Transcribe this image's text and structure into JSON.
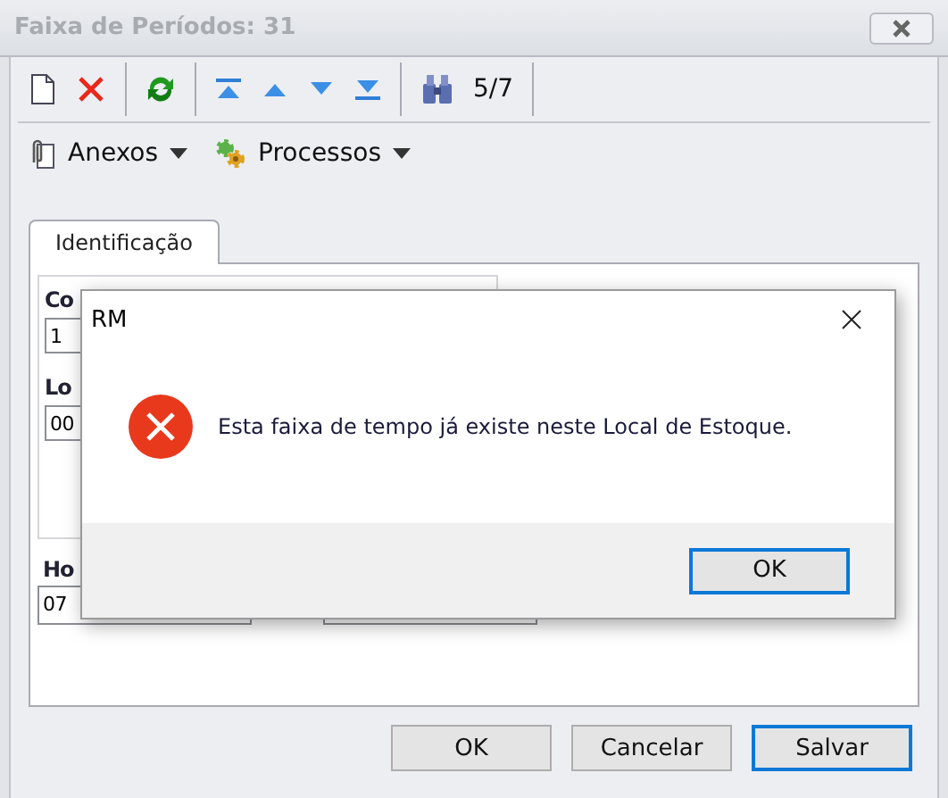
{
  "window": {
    "title": "Faixa de Períodos: 31"
  },
  "toolbar": {
    "counter": "5/7"
  },
  "menus": [
    {
      "label": "Anexos",
      "kind": "attachments"
    },
    {
      "label": "Processos",
      "kind": "processes"
    }
  ],
  "tabs": [
    {
      "label": "Identificação",
      "selected": true
    }
  ],
  "form": {
    "fields": [
      {
        "label": "Co",
        "value": "1"
      },
      {
        "label": "Lo",
        "value": "00"
      }
    ],
    "bottom_label": "Ho",
    "bottom_value": "07"
  },
  "buttons": [
    {
      "label": "OK",
      "default": false
    },
    {
      "label": "Cancelar",
      "default": false
    },
    {
      "label": "Salvar",
      "default": true
    }
  ],
  "dialog": {
    "title": "RM",
    "message": "Esta faixa de tempo já existe neste Local de Estoque.",
    "button": "OK"
  }
}
